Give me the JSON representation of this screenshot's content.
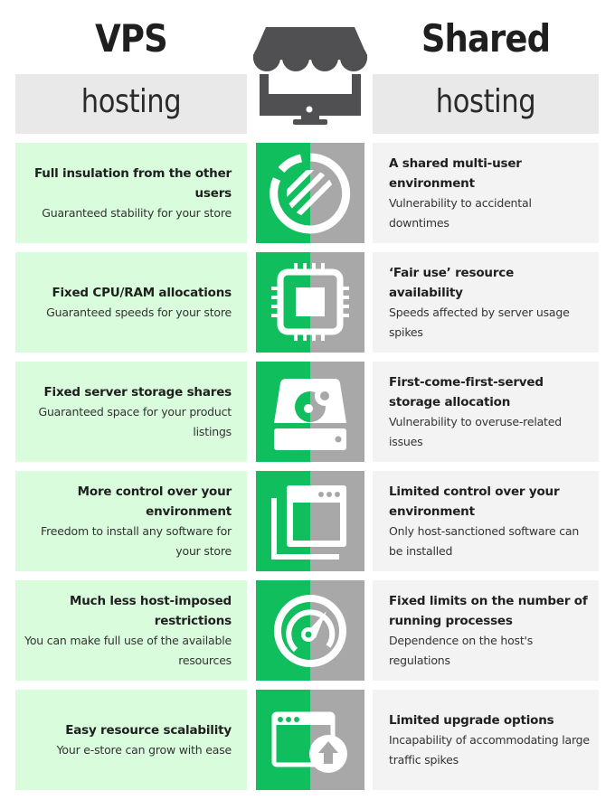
{
  "header": {
    "left_title": "VPS",
    "left_subtitle": "hosting",
    "right_title": "Shared",
    "right_subtitle": "hosting",
    "center_icon": "storefront-monitor-icon"
  },
  "colors": {
    "vps_bg": "#d9fcdc",
    "shared_bg": "#f3f3f3",
    "icon_green": "#10be5d",
    "icon_gray": "#a8a8a8",
    "header_band": "#e9e9e9",
    "store_icon": "#505052"
  },
  "rows": [
    {
      "icon": "isolation-circle-icon",
      "vps": {
        "heading": "Full insulation from the other users",
        "detail": "Guaranteed stability for your store"
      },
      "shared": {
        "heading": "A shared multi-user environment",
        "detail": "Vulnerability to accidental downtimes"
      }
    },
    {
      "icon": "cpu-chip-icon",
      "vps": {
        "heading": "Fixed CPU/RAM allocations",
        "detail": "Guaranteed speeds for your store"
      },
      "shared": {
        "heading": "‘Fair use’ resource availability",
        "detail": "Speeds affected by server usage spikes"
      }
    },
    {
      "icon": "hard-drive-icon",
      "vps": {
        "heading": "Fixed server storage shares",
        "detail": "Guaranteed space for your product listings"
      },
      "shared": {
        "heading": "First-come-first-served storage allocation",
        "detail": "Vulnerability to overuse-related issues"
      }
    },
    {
      "icon": "stacked-windows-icon",
      "vps": {
        "heading": "More control over your environment",
        "detail": "Freedom to install any software for your store"
      },
      "shared": {
        "heading": "Limited control over your environment",
        "detail": "Only host-sanctioned software can be installed"
      }
    },
    {
      "icon": "speedometer-gauge-icon",
      "vps": {
        "heading": "Much less host-imposed restrictions",
        "detail": "You can make full use of the available resources"
      },
      "shared": {
        "heading": "Fixed limits on the number of running processes",
        "detail": "Dependence on the host's regulations"
      }
    },
    {
      "icon": "window-upgrade-arrow-icon",
      "vps": {
        "heading": "Easy resource scalability",
        "detail": "Your e-store can grow with ease"
      },
      "shared": {
        "heading": "Limited upgrade options",
        "detail": "Incapability of accommodating large traffic spikes"
      }
    }
  ]
}
